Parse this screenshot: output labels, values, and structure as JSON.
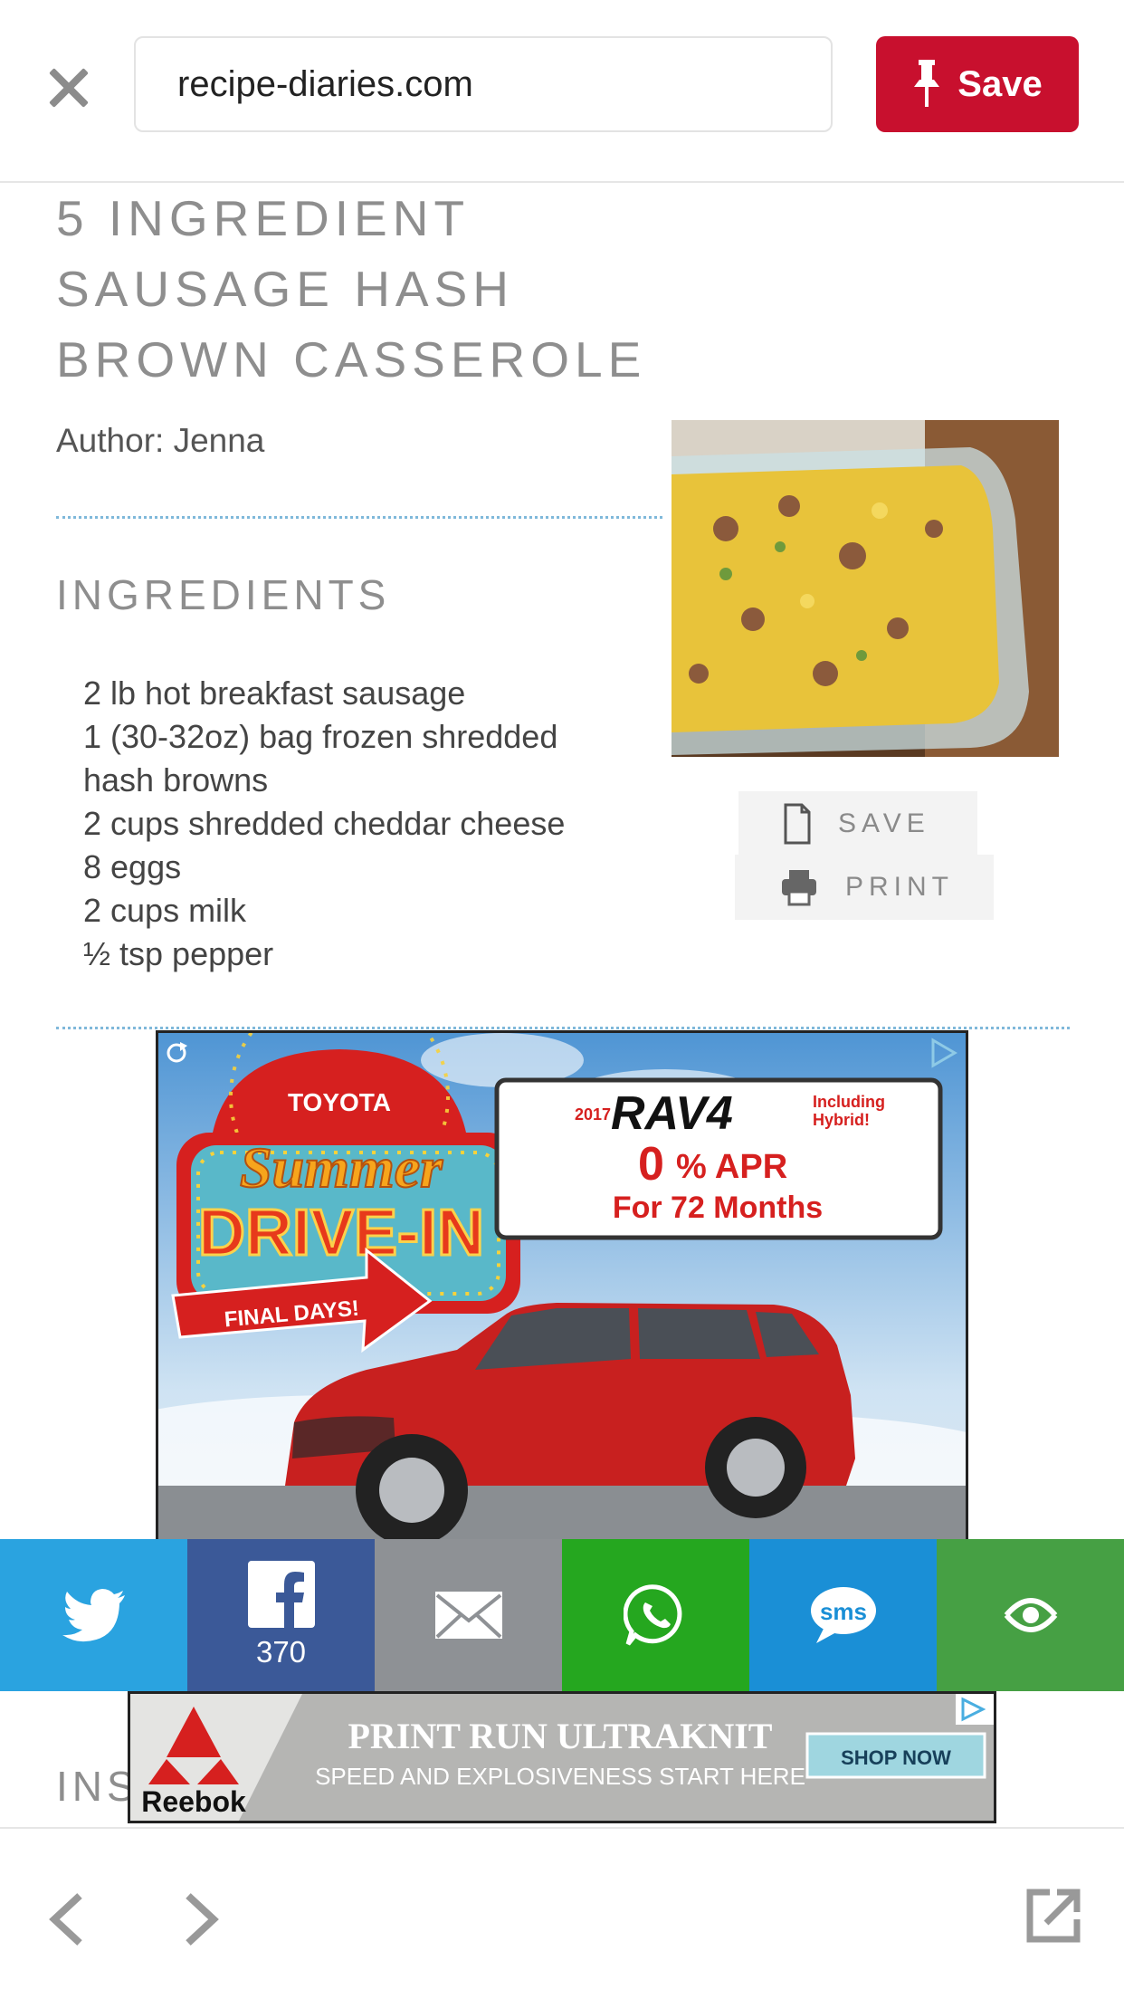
{
  "topbar": {
    "url": "recipe-diaries.com",
    "save_label": "Save"
  },
  "recipe": {
    "title_lines": [
      "5 INGREDIENT",
      "SAUSAGE HASH",
      "BROWN CASSEROLE"
    ],
    "author": "Author: Jenna",
    "ingredients_heading": "INGREDIENTS",
    "ingredients": [
      "2 lb hot breakfast sausage",
      "1 (30-32oz) bag frozen shredded",
      "hash browns",
      "2 cups shredded cheddar cheese",
      "8 eggs",
      "2 cups milk",
      "½ tsp pepper"
    ],
    "save_label": "SAVE",
    "print_label": "PRINT",
    "instructions_heading_partial": "INS"
  },
  "toyota_ad": {
    "brand": "TOYOTA",
    "headline1": "Summer",
    "headline2": "DRIVE-IN",
    "ribbon": "FINAL DAYS!",
    "year": "2017",
    "model": "RAV4",
    "model_note1": "Including",
    "model_note2": "Hybrid!",
    "apr_value": "0",
    "apr_unit": "% APR",
    "apr_terms": "For 72 Months"
  },
  "share": {
    "facebook_count": "370"
  },
  "reebok_ad": {
    "brand": "Reebok",
    "headline": "PRINT RUN ULTRAKNIT",
    "subline": "SPEED AND EXPLOSIVENESS START HERE",
    "cta": "SHOP NOW"
  },
  "colors": {
    "pinterest_red": "#c8102e",
    "twitter": "#2aa3e0",
    "facebook": "#3b5998",
    "email": "#8e9195",
    "whatsapp": "#25a71f",
    "sms": "#1a8fd6",
    "more": "#46a044"
  },
  "icons": [
    "close-icon",
    "pin-icon",
    "document-icon",
    "printer-icon",
    "twitter-icon",
    "facebook-icon",
    "email-icon",
    "whatsapp-icon",
    "sms-icon",
    "share-more-icon",
    "chevron-left-icon",
    "chevron-right-icon",
    "open-external-icon",
    "adchoices-icon",
    "refresh-icon"
  ]
}
